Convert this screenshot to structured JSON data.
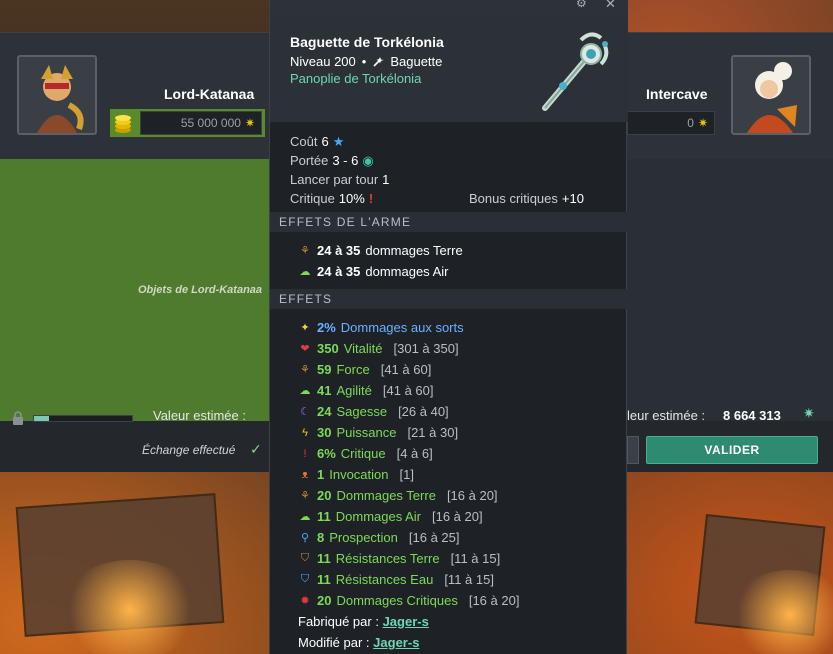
{
  "exchange": {
    "left_player": {
      "name": "Lord-Katanaa",
      "kamas": "55 000 000",
      "objects_label": "Objets de Lord-Katanaa",
      "estimated_label": "Valeur estimée :",
      "progress_fraction": 0.15
    },
    "right_player": {
      "name": "Intercave",
      "kamas": "0",
      "estimated_label": "leur estimée :",
      "estimated_value": "8 664 313"
    },
    "done_label": "Échange effectué",
    "validate_label": "VALIDER"
  },
  "tooltip": {
    "item_name": "Baguette de Torkélonia",
    "level": "Niveau 200",
    "item_type": "Baguette",
    "set_name": "Panoplie de Torkélonia",
    "stats": {
      "cost_label": "Coût",
      "cost_value": "6",
      "range_label": "Portée",
      "range_value": "3 - 6",
      "casts_label": "Lancer par tour",
      "casts_value": "1",
      "crit_label": "Critique",
      "crit_value": "10%",
      "crit_bonus_label": "Bonus critiques",
      "crit_bonus_value": "+10"
    },
    "weapon_effects_title": "EFFETS DE L'ARME",
    "weapon_effects": [
      {
        "icon": "earth-icon",
        "value": "24 à 35",
        "text": "dommages Terre"
      },
      {
        "icon": "air-icon",
        "value": "24 à 35",
        "text": "dommages Air"
      }
    ],
    "effects_title": "EFFETS",
    "effects": [
      {
        "icon": "spell-damage-icon",
        "value": "2%",
        "text": "Dommages aux sorts",
        "range": ""
      },
      {
        "icon": "heart-icon",
        "value": "350",
        "text": "Vitalité",
        "range": "[301 à 350]"
      },
      {
        "icon": "earth-icon",
        "value": "59",
        "text": "Force",
        "range": "[41 à 60]"
      },
      {
        "icon": "air-icon",
        "value": "41",
        "text": "Agilité",
        "range": "[41 à 60]"
      },
      {
        "icon": "wisdom-icon",
        "value": "24",
        "text": "Sagesse",
        "range": "[26 à 40]"
      },
      {
        "icon": "power-icon",
        "value": "30",
        "text": "Puissance",
        "range": "[21 à 30]"
      },
      {
        "icon": "critical-icon",
        "value": "6%",
        "text": "Critique",
        "range": "[4 à 6]"
      },
      {
        "icon": "summon-icon",
        "value": "1",
        "text": "Invocation",
        "range": "[1]"
      },
      {
        "icon": "earth-icon",
        "value": "20",
        "text": "Dommages Terre",
        "range": "[16 à 20]"
      },
      {
        "icon": "air-icon",
        "value": "11",
        "text": "Dommages Air",
        "range": "[16 à 20]"
      },
      {
        "icon": "prospecting-icon",
        "value": "8",
        "text": "Prospection",
        "range": "[16 à 25]"
      },
      {
        "icon": "earth-resistance-icon",
        "value": "11",
        "text": "Résistances Terre",
        "range": "[11 à 15]"
      },
      {
        "icon": "water-resistance-icon",
        "value": "11",
        "text": "Résistances Eau",
        "range": "[11 à 15]"
      },
      {
        "icon": "critical-damage-icon",
        "value": "20",
        "text": "Dommages Critiques",
        "range": "[16 à 20]"
      }
    ],
    "crafted_label": "Fabriqué par :",
    "crafted_by": "Jager-s",
    "modified_label": "Modifié par :",
    "modified_by": "Jager-s"
  }
}
